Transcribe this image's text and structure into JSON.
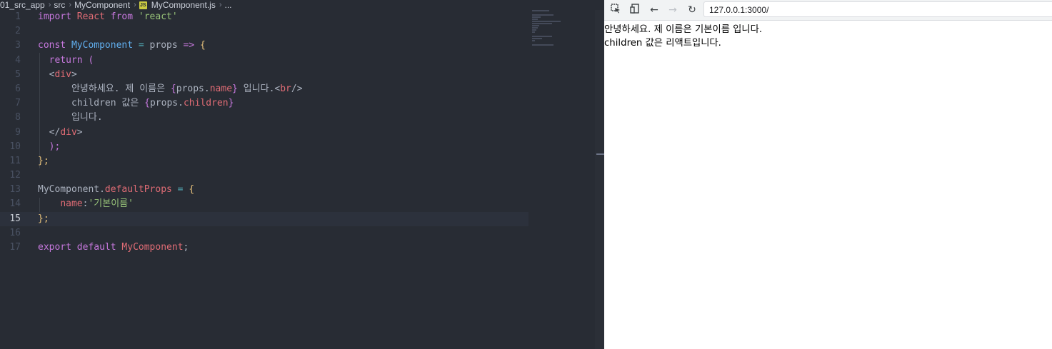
{
  "editor": {
    "breadcrumb": [
      "01_src_app",
      "src",
      "MyComponent",
      "MyComponent.js",
      "..."
    ],
    "breadcrumb_badge": "JS",
    "line_numbers": [
      "1",
      "2",
      "3",
      "4",
      "5",
      "6",
      "7",
      "8",
      "9",
      "10",
      "11",
      "12",
      "13",
      "14",
      "15",
      "16",
      "17"
    ],
    "active_line": "15",
    "code": {
      "l1": [
        "import",
        "React",
        "from",
        "'react'"
      ],
      "l3": [
        "const",
        "MyComponent",
        "=",
        "props",
        "=>",
        "{"
      ],
      "l4": [
        "return",
        "("
      ],
      "l5": [
        "<",
        "div",
        ">"
      ],
      "l6": [
        "안녕하세요. 제 이름은 ",
        "{",
        "props",
        ".",
        "name",
        "}",
        " 입니다.",
        "<",
        "br",
        "/>"
      ],
      "l7": [
        "children 값은 ",
        "{",
        "props",
        ".",
        "children",
        "}"
      ],
      "l8": [
        "입니다."
      ],
      "l9": [
        "</",
        "div",
        ">"
      ],
      "l10": [
        ");"
      ],
      "l11": [
        "};"
      ],
      "l13": [
        "MyComponent",
        ".",
        "defaultProps",
        "=",
        "{"
      ],
      "l14": [
        "name",
        ":",
        "'기본이름'"
      ],
      "l15": [
        "};"
      ],
      "l17": [
        "export",
        "default",
        "MyComponent",
        ";"
      ]
    }
  },
  "browser": {
    "toolbar_icons": [
      "inspect-icon",
      "device-toggle-icon",
      "back-icon",
      "forward-icon",
      "reload-icon"
    ],
    "url": "127.0.0.1:3000/",
    "content": {
      "line1": "안녕하세요. 제 이름은 기본이름 입니다.",
      "line2": "children 값은 리액트입니다."
    }
  }
}
